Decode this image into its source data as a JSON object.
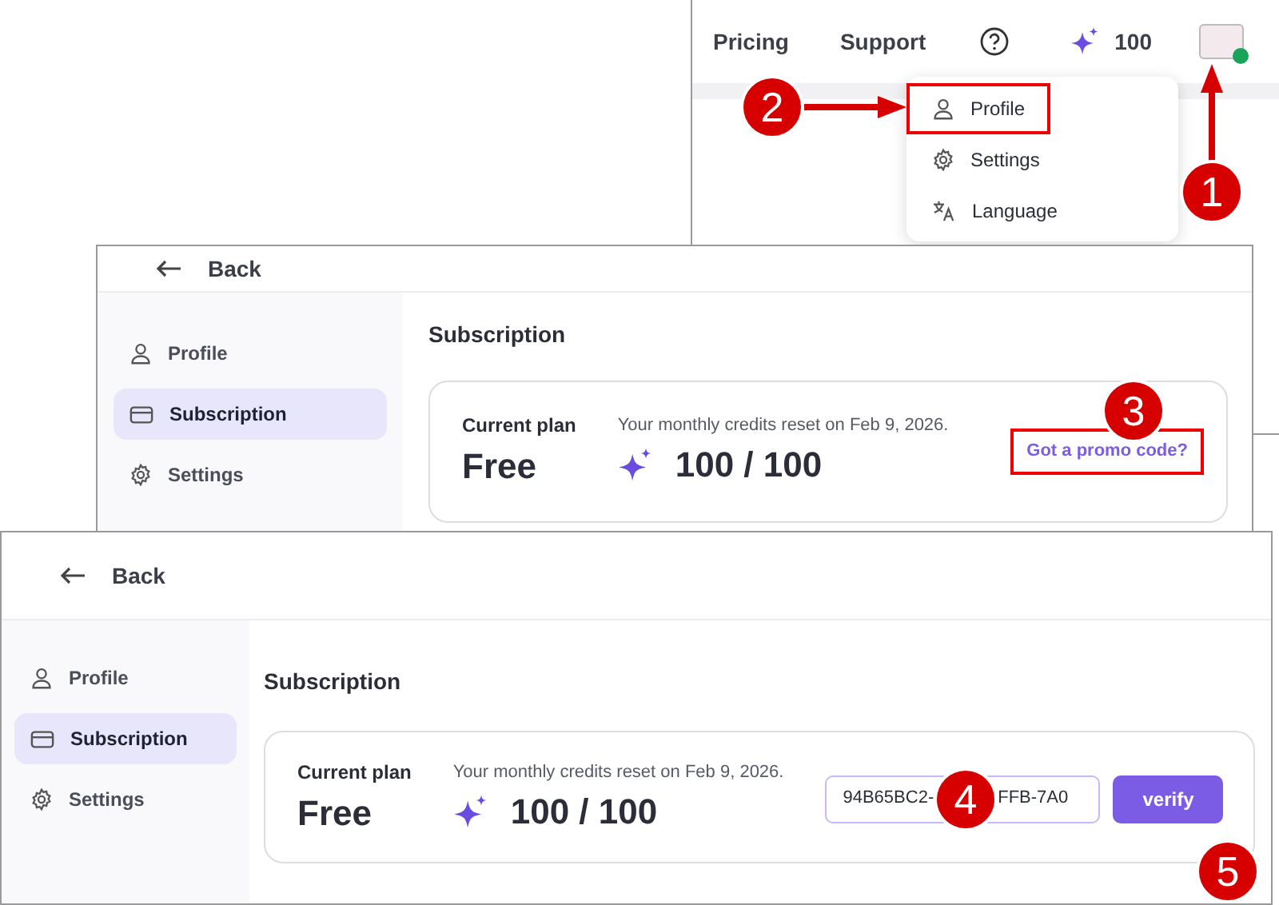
{
  "windows": [
    {
      "kind": "topbar",
      "nav": [
        "Pricing",
        "Support"
      ],
      "credits": "100",
      "menu": [
        {
          "label": "Profile",
          "highlighted": true
        },
        {
          "label": "Settings",
          "highlighted": false
        },
        {
          "label": "Language",
          "highlighted": false
        }
      ]
    },
    {
      "kind": "subscription",
      "back": "Back",
      "sidebar": [
        {
          "label": "Profile",
          "selected": false
        },
        {
          "label": "Subscription",
          "selected": true
        },
        {
          "label": "Settings",
          "selected": false
        }
      ],
      "title": "Subscription",
      "plan_label": "Current plan",
      "plan": "Free",
      "reset_note": "Your monthly credits reset on Feb 9, 2026.",
      "credits": "100 / 100",
      "promo": {
        "kind": "link",
        "text": "Got a promo code?",
        "highlighted": true
      }
    },
    {
      "kind": "subscription",
      "back": "Back",
      "sidebar": [
        {
          "label": "Profile",
          "selected": false
        },
        {
          "label": "Subscription",
          "selected": true
        },
        {
          "label": "Settings",
          "selected": false
        }
      ],
      "title": "Subscription",
      "plan_label": "Current plan",
      "plan": "Free",
      "reset_note": "Your monthly credits reset on Feb 9, 2026.",
      "credits": "100 / 100",
      "promo": {
        "kind": "form",
        "value_parts": [
          "94B65BC2-",
          "FFB-7A0"
        ],
        "button": "verify",
        "highlighted": false
      }
    }
  ],
  "annotations": [
    {
      "number": "1"
    },
    {
      "number": "2"
    },
    {
      "number": "3"
    },
    {
      "number": "4"
    },
    {
      "number": "5"
    }
  ]
}
